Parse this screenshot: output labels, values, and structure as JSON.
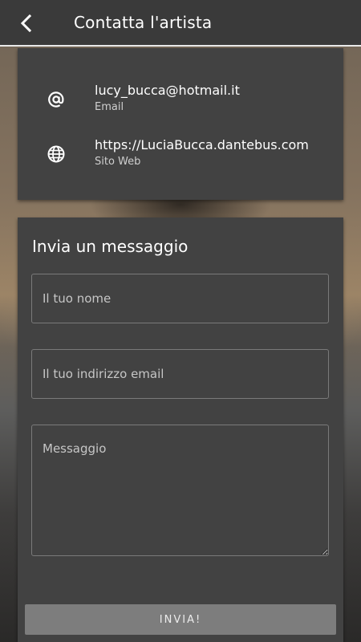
{
  "header": {
    "title": "Contatta l'artista",
    "back_icon": "chevron-left-icon"
  },
  "contact_info": {
    "items": [
      {
        "icon": "at-sign-icon",
        "value": "lucy_bucca@hotmail.it",
        "caption": "Email"
      },
      {
        "icon": "globe-icon",
        "value": "https://LuciaBucca.dantebus.com",
        "caption": "Sito Web"
      }
    ]
  },
  "message_form": {
    "title": "Invia un messaggio",
    "name_field": {
      "placeholder": "Il tuo nome",
      "value": ""
    },
    "email_field": {
      "placeholder": "Il tuo indirizzo email",
      "value": ""
    },
    "message_field": {
      "placeholder": "Messaggio",
      "value": ""
    },
    "submit_label": "INVIA!"
  },
  "colors": {
    "appbar": "#3a3a3a",
    "card": "#424242",
    "button": "#7d7d7d",
    "text": "#ffffff"
  }
}
